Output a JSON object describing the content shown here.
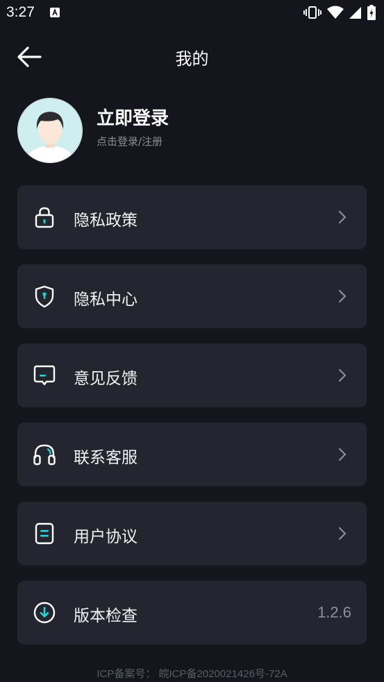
{
  "status_bar": {
    "time": "3:27"
  },
  "header": {
    "title": "我的"
  },
  "profile": {
    "name": "立即登录",
    "subtitle": "点击登录/注册"
  },
  "menu": {
    "items": [
      {
        "label": "隐私政策",
        "icon": "lock-icon"
      },
      {
        "label": "隐私中心",
        "icon": "shield-icon"
      },
      {
        "label": "意见反馈",
        "icon": "feedback-icon"
      },
      {
        "label": "联系客服",
        "icon": "headset-icon"
      },
      {
        "label": "用户协议",
        "icon": "document-icon"
      },
      {
        "label": "版本检查",
        "icon": "download-icon",
        "value": "1.2.6"
      }
    ]
  },
  "footer": {
    "icp": "ICP备案号： 皖ICP备2020021426号-72A"
  },
  "colors": {
    "background": "#14161d",
    "card": "#23252f",
    "accent": "#1fd6d3"
  }
}
